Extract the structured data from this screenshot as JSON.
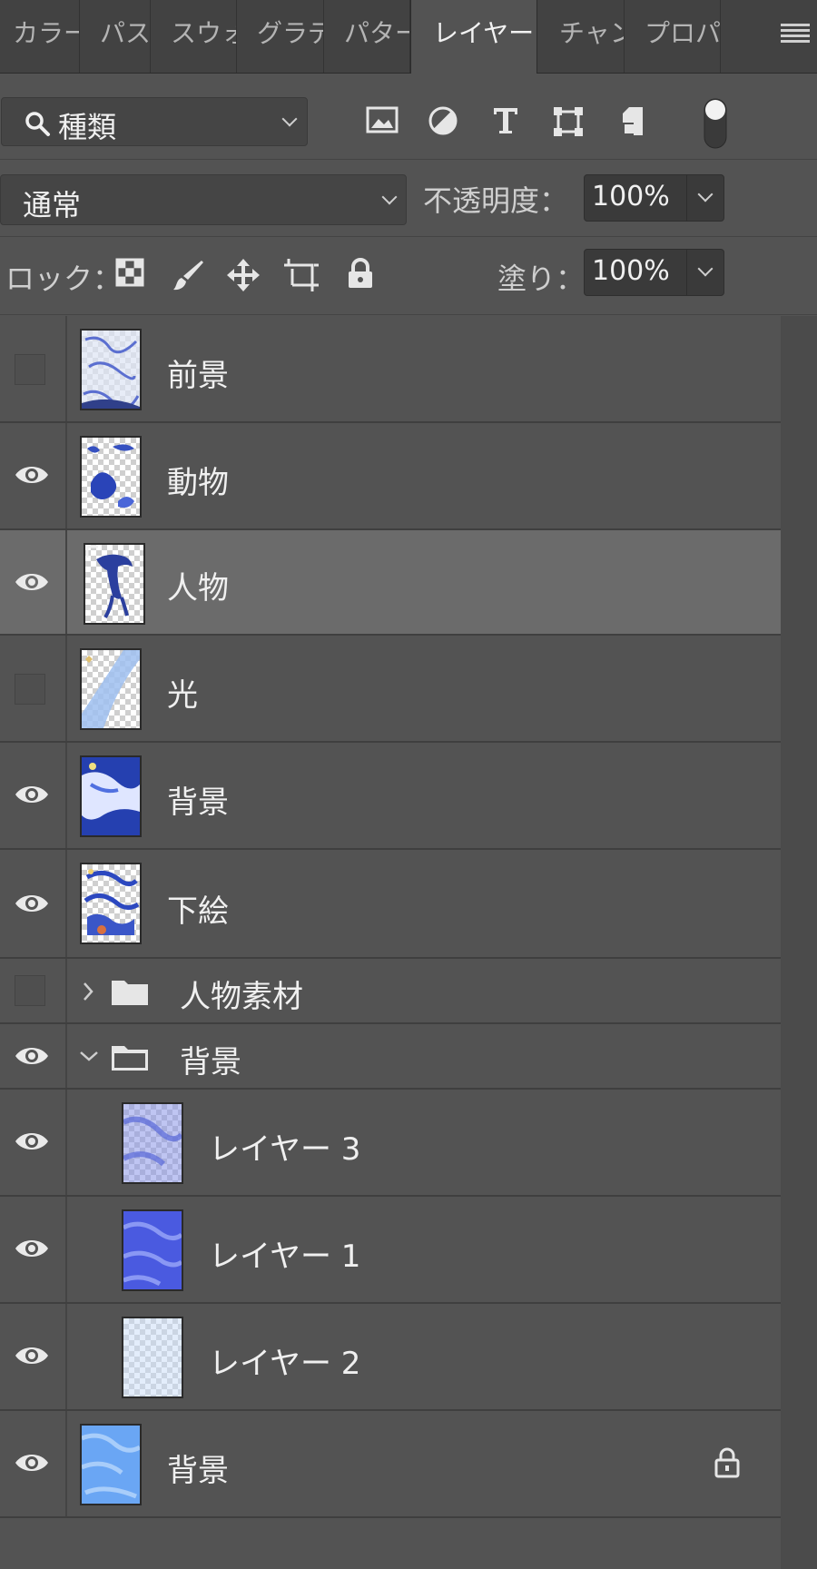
{
  "tabs": [
    {
      "label": "カラー",
      "active": false
    },
    {
      "label": "パス",
      "active": false
    },
    {
      "label": "スウォ",
      "active": false
    },
    {
      "label": "グラデ",
      "active": false
    },
    {
      "label": "パター",
      "active": false
    },
    {
      "label": "レイヤー",
      "active": true
    },
    {
      "label": "チャン",
      "active": false
    },
    {
      "label": "プロパ",
      "active": false
    }
  ],
  "filter": {
    "kind_label": "種類",
    "icons": [
      "image-filter-icon",
      "adjustment-filter-icon",
      "type-filter-icon",
      "shape-filter-icon",
      "smart-object-filter-icon"
    ]
  },
  "blend": {
    "mode": "通常",
    "opacity_label": "不透明度：",
    "opacity_value": "100%"
  },
  "lock": {
    "label": "ロック：",
    "fill_label": "塗り：",
    "fill_value": "100%"
  },
  "layers": [
    {
      "name": "前景",
      "visible": false,
      "selected": false,
      "type": "layer"
    },
    {
      "name": "動物",
      "visible": true,
      "selected": false,
      "type": "layer"
    },
    {
      "name": "人物",
      "visible": true,
      "selected": true,
      "type": "layer"
    },
    {
      "name": "光",
      "visible": false,
      "selected": false,
      "type": "layer"
    },
    {
      "name": "背景",
      "visible": true,
      "selected": false,
      "type": "layer"
    },
    {
      "name": "下絵",
      "visible": true,
      "selected": false,
      "type": "layer"
    },
    {
      "name": "人物素材",
      "visible": false,
      "selected": false,
      "type": "group",
      "expanded": false
    },
    {
      "name": "背景",
      "visible": true,
      "selected": false,
      "type": "group",
      "expanded": true
    },
    {
      "name": "レイヤー 3",
      "visible": true,
      "selected": false,
      "type": "layer",
      "indented": true
    },
    {
      "name": "レイヤー 1",
      "visible": true,
      "selected": false,
      "type": "layer",
      "indented": true
    },
    {
      "name": "レイヤー 2",
      "visible": true,
      "selected": false,
      "type": "layer",
      "indented": true
    },
    {
      "name": "背景",
      "visible": true,
      "selected": false,
      "type": "background",
      "locked": true
    }
  ],
  "colors": {
    "panel_bg": "#535353",
    "tabbar_bg": "#424242",
    "selected_row": "#6b6b6b",
    "thumb_blue": "#3050c8"
  }
}
